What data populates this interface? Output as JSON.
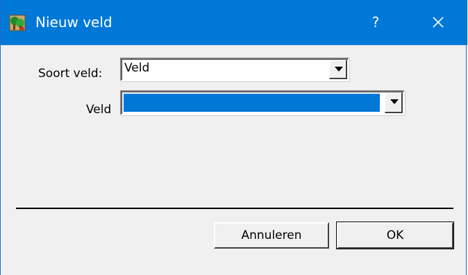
{
  "window": {
    "title": "Nieuw veld",
    "help_glyph": "?",
    "icon": "app-tree-icon"
  },
  "form": {
    "soort_label": "Soort veld:",
    "soort_value": "Veld",
    "veld_label": "Veld",
    "veld_value": ""
  },
  "buttons": {
    "cancel_label": "Annuleren",
    "ok_label": "OK"
  },
  "colors": {
    "titlebar": "#0078d7",
    "selection": "#0078d7",
    "background": "#f0f0f0"
  }
}
